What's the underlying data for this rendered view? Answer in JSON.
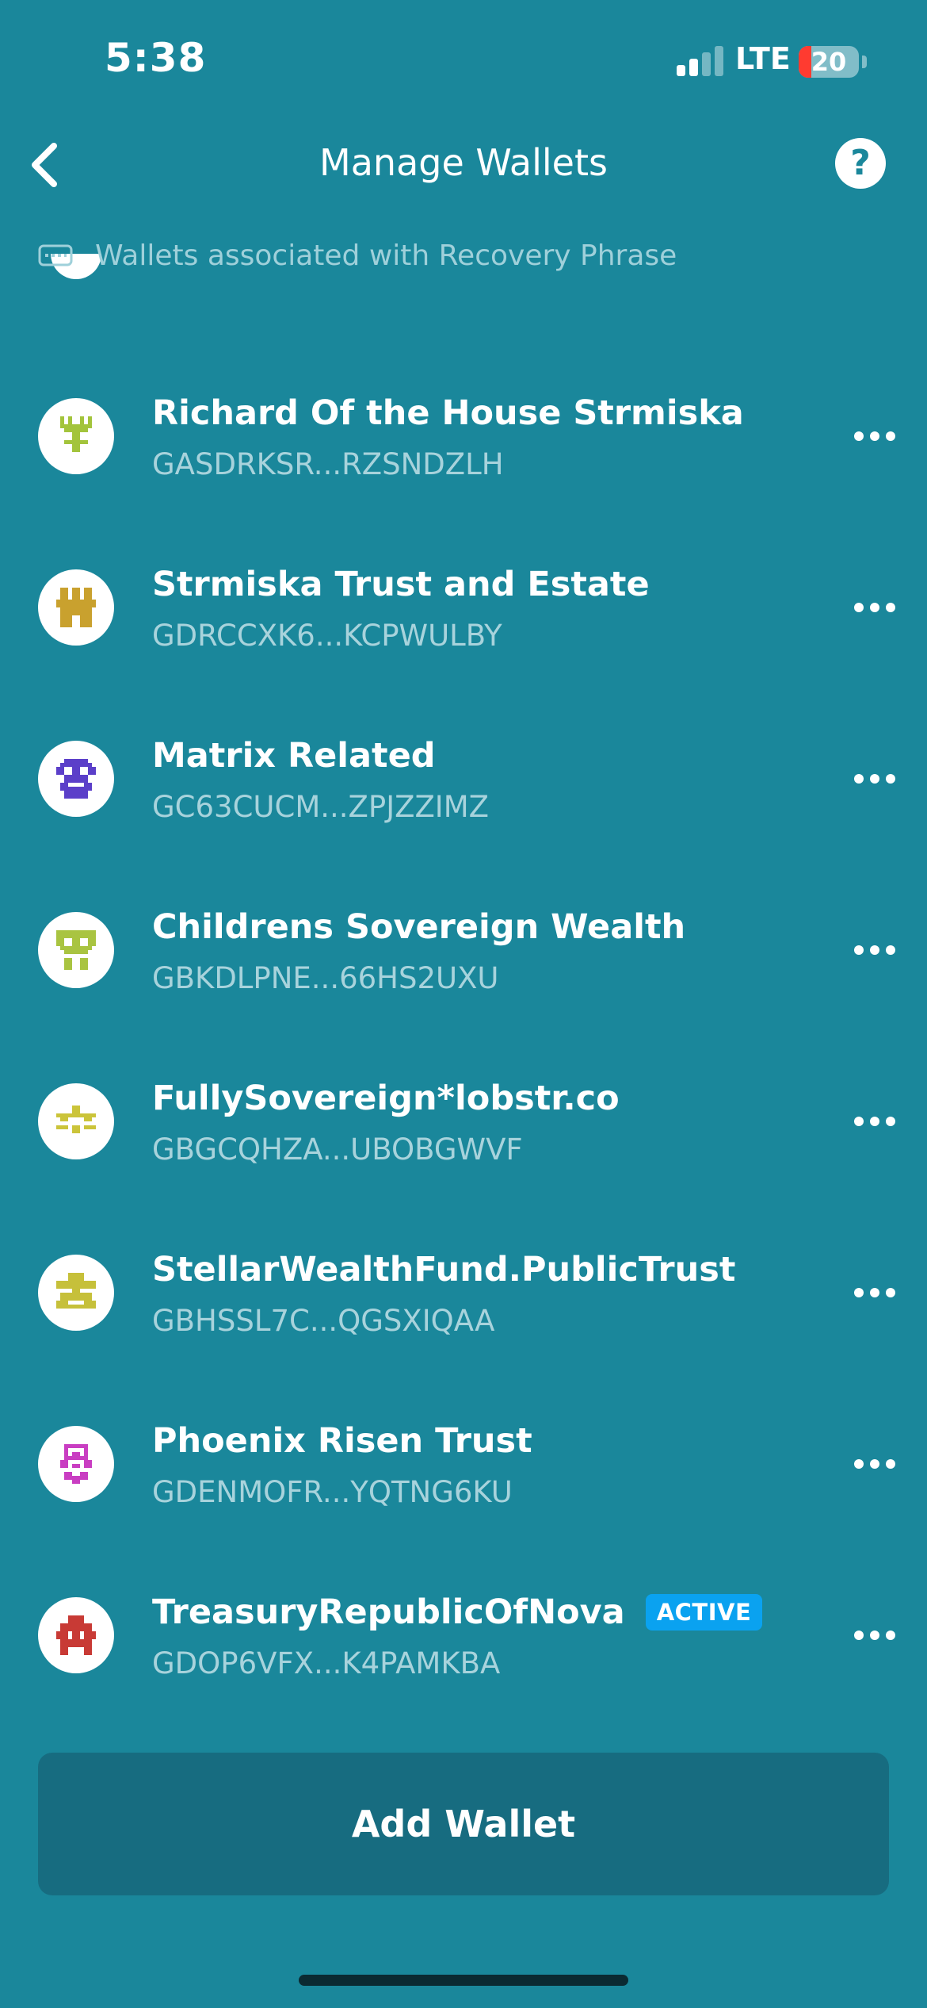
{
  "status_bar": {
    "time": "5:38",
    "network": "LTE",
    "battery": "20",
    "battery_level": 0.2,
    "signal_bars_active": 2,
    "signal_bars_total": 4
  },
  "header": {
    "title": "Manage Wallets",
    "back_icon": "chevron-left-icon",
    "help_icon": "question-icon",
    "help_label": "?"
  },
  "section": {
    "label": "Wallets associated with Recovery Phrase",
    "icon": "keyboard-icon"
  },
  "wallets": [
    {
      "name": "Richard Of the House Strmiska",
      "address": "GASDRKSR...RZSNDZLH",
      "avatar_color": "#a3c43c",
      "active": false
    },
    {
      "name": "Strmiska Trust and Estate",
      "address": "GDRCCXK6...KCPWULBY",
      "avatar_color": "#c9a12e",
      "active": false
    },
    {
      "name": "Matrix Related",
      "address": "GC63CUCM...ZPJZZIMZ",
      "avatar_color": "#5b3fc9",
      "active": false
    },
    {
      "name": "Childrens Sovereign Wealth",
      "address": "GBKDLPNE...66HS2UXU",
      "avatar_color": "#a9c441",
      "active": false
    },
    {
      "name": "FullySovereign*lobstr.co",
      "address": "GBGCQHZA...UBOBGWVF",
      "avatar_color": "#cbc43a",
      "active": false
    },
    {
      "name": "StellarWealthFund.PublicTrust",
      "address": "GBHSSL7C...QGSXIQAA",
      "avatar_color": "#c6c03a",
      "active": false
    },
    {
      "name": "Phoenix Risen Trust",
      "address": "GDENMOFR...YQTNG6KU",
      "avatar_color": "#c93ec2",
      "active": false
    },
    {
      "name": "TreasuryRepublicOfNova",
      "address": "GDOP6VFX...K4PAMKBA",
      "avatar_color": "#c83a35",
      "active": true
    }
  ],
  "active_label": "ACTIVE",
  "add_wallet_label": "Add Wallet",
  "colors": {
    "background": "#1a879b",
    "button": "#176c80",
    "active_badge": "#0aa2f0",
    "address_text": "#a8d3dc"
  }
}
